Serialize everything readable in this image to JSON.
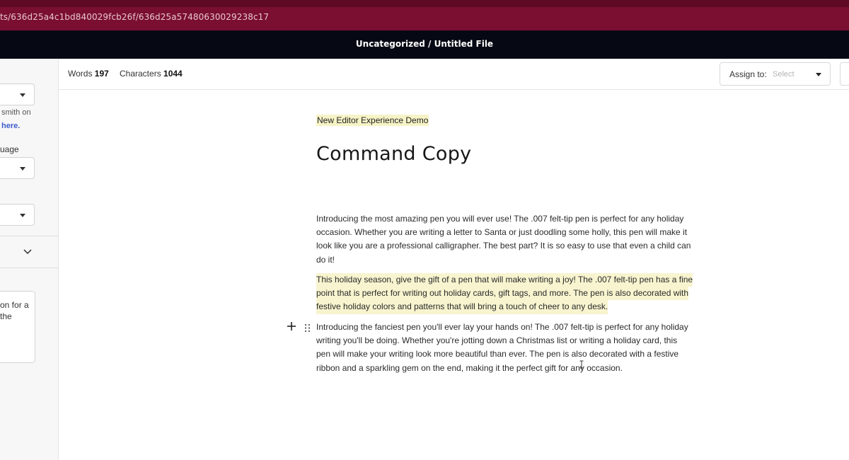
{
  "browser": {
    "url": "ts/636d25a4c1bd840029fcb26f/636d25a57480630029238c17"
  },
  "app": {
    "breadcrumb": "Uncategorized / Untitled File"
  },
  "sidebar": {
    "author_fragment": "smith on",
    "link_fragment": "here.",
    "language_label_fragment": "uage",
    "card_text_line1": "on for a",
    "card_text_line2": "the"
  },
  "toolbar": {
    "words_label": "Words",
    "words_value": "197",
    "characters_label": "Characters",
    "characters_value": "1044",
    "assign_label": "Assign to:",
    "assign_placeholder": "Select"
  },
  "editor": {
    "tag": "New Editor Experience Demo",
    "title": "Command Copy",
    "paragraphs": [
      {
        "highlighted": false,
        "lines": [
          "Introducing the most amazing pen you will ever use! The .007 felt-tip pen is perfect for any holiday",
          "occasion. Whether you are writing a letter to Santa or just doodling some holly, this pen will make it",
          "look like you are a professional calligrapher. The best part? It is so easy to use that even a child can",
          "do it!"
        ]
      },
      {
        "highlighted": true,
        "lines": [
          "This holiday season, give the gift of a pen that will make writing a joy! The .007 felt-tip pen has a fine",
          "point that is perfect for writing out holiday cards, gift tags, and more. The pen is also decorated with",
          "festive holiday colors and patterns that will bring a touch of cheer to any desk."
        ]
      },
      {
        "highlighted": false,
        "lines": [
          "Introducing the fanciest pen you'll ever lay your hands on! The .007 felt-tip is perfect for any holiday",
          "writing you'll be doing. Whether you're jotting down a Christmas list or writing a holiday card, this",
          "pen will make your writing look more beautiful than ever. The pen is also decorated with a festive",
          "ribbon and a sparkling gem on the end, making it the perfect gift for any occasion."
        ]
      }
    ]
  },
  "colors": {
    "browser_frame": "#7a0f32",
    "app_header": "#060914",
    "highlight": "#f7f4cf"
  }
}
